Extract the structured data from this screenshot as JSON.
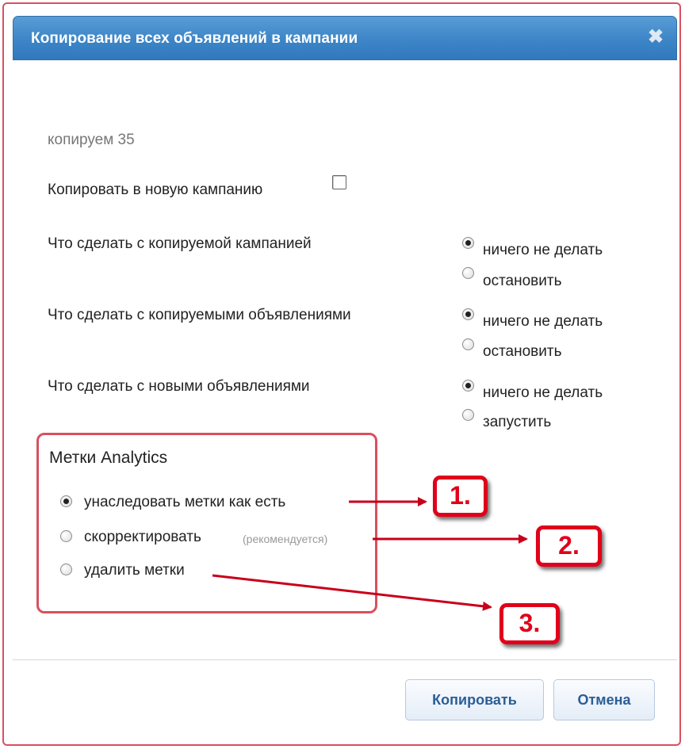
{
  "dialog": {
    "title": "Копирование всех объявлений в кампании",
    "close_icon": "✖"
  },
  "copy_count_text": "копируем 35",
  "new_campaign": {
    "label": "Копировать в новую кампанию",
    "checked": false
  },
  "options": [
    {
      "label": "Что сделать с копируемой кампанией",
      "choices": [
        {
          "label": "ничего не делать",
          "selected": true
        },
        {
          "label": "остановить",
          "selected": false
        }
      ]
    },
    {
      "label": "Что сделать с копируемыми объявлениями",
      "choices": [
        {
          "label": "ничего не делать",
          "selected": true
        },
        {
          "label": "остановить",
          "selected": false
        }
      ]
    },
    {
      "label": "Что сделать с новыми объявлениями",
      "choices": [
        {
          "label": "ничего не делать",
          "selected": true
        },
        {
          "label": "запустить",
          "selected": false
        }
      ]
    }
  ],
  "analytics": {
    "title": "Метки Analytics",
    "choices": [
      {
        "label": "унаследовать метки как есть",
        "selected": true,
        "note": ""
      },
      {
        "label": "скорректировать",
        "selected": false,
        "note": "(рекомендуется)"
      },
      {
        "label": "удалить метки",
        "selected": false,
        "note": ""
      }
    ]
  },
  "annotations": [
    "1.",
    "2.",
    "3."
  ],
  "buttons": {
    "copy": "Копировать",
    "cancel": "Отмена"
  },
  "colors": {
    "titlebar": "#3c85c7",
    "annotation_red": "#e1001a",
    "button_text": "#2a5d97"
  }
}
